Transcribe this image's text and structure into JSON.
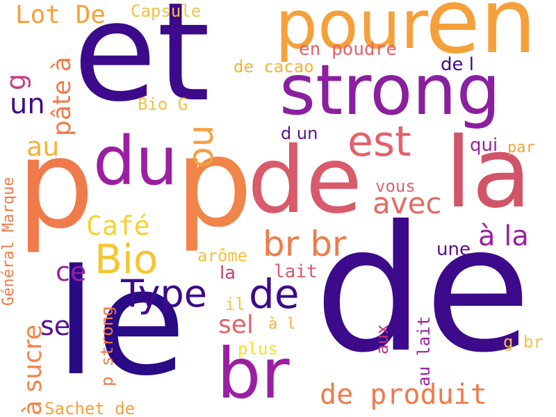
{
  "words": [
    {
      "text": "et",
      "color": "#3c0a8a",
      "rotated": false
    },
    {
      "text": "de",
      "color": "#3c0a8a",
      "rotated": false
    },
    {
      "text": "le",
      "color": "#2a0b86",
      "rotated": false
    },
    {
      "text": "p",
      "color": "#f07b4a",
      "rotated": false
    },
    {
      "text": "p",
      "color": "#f18448",
      "rotated": false
    },
    {
      "text": "de",
      "color": "#d95a6a",
      "rotated": false
    },
    {
      "text": "la",
      "color": "#d05569",
      "rotated": false
    },
    {
      "text": "en",
      "color": "#f6a03c",
      "rotated": false
    },
    {
      "text": "pour",
      "color": "#f6a03c",
      "rotated": false
    },
    {
      "text": "strong",
      "color": "#8a1fa0",
      "rotated": false
    },
    {
      "text": "du",
      "color": "#9b1fa2",
      "rotated": false
    },
    {
      "text": "br",
      "color": "#9b1fa2",
      "rotated": false
    },
    {
      "text": "Bio",
      "color": "#f8c52f",
      "rotated": false
    },
    {
      "text": "Type",
      "color": "#3c0a8a",
      "rotated": false
    },
    {
      "text": "de",
      "color": "#3c0a8a",
      "rotated": false
    },
    {
      "text": "est",
      "color": "#e4626a",
      "rotated": false
    },
    {
      "text": "br br",
      "color": "#f07b4a",
      "rotated": false
    },
    {
      "text": "avec",
      "color": "#e16b62",
      "rotated": false
    },
    {
      "text": "à la",
      "color": "#9b1fa2",
      "rotated": false
    },
    {
      "text": "de produit",
      "color": "#f07b4a",
      "rotated": false
    },
    {
      "text": "Lot De",
      "color": "#f6a03c",
      "rotated": false
    },
    {
      "text": "Capsule",
      "color": "#f6c040",
      "rotated": false
    },
    {
      "text": "en poudre",
      "color": "#e4626a",
      "rotated": false
    },
    {
      "text": "de cacao",
      "color": "#f6b334",
      "rotated": false
    },
    {
      "text": "de l",
      "color": "#3c0a8a",
      "rotated": false
    },
    {
      "text": "un",
      "color": "#3c0a8a",
      "rotated": false
    },
    {
      "text": "Bio G",
      "color": "#f6c040",
      "rotated": false
    },
    {
      "text": "d un",
      "color": "#5a0d8f",
      "rotated": false
    },
    {
      "text": "qui",
      "color": "#9b1fa2",
      "rotated": false
    },
    {
      "text": "par",
      "color": "#f6a03c",
      "rotated": false
    },
    {
      "text": "au",
      "color": "#f6b334",
      "rotated": false
    },
    {
      "text": "Café",
      "color": "#f8d22c",
      "rotated": false
    },
    {
      "text": "ce",
      "color": "#9b1fa2",
      "rotated": false
    },
    {
      "text": "se",
      "color": "#5a0d8f",
      "rotated": false
    },
    {
      "text": "sel",
      "color": "#e4626a",
      "rotated": false
    },
    {
      "text": "vous",
      "color": "#e4626a",
      "rotated": false
    },
    {
      "text": "une",
      "color": "#5a0d8f",
      "rotated": false
    },
    {
      "text": "arôme",
      "color": "#f6c040",
      "rotated": false
    },
    {
      "text": "la",
      "color": "#c83f7a",
      "rotated": false
    },
    {
      "text": "lait",
      "color": "#d95a6a",
      "rotated": false
    },
    {
      "text": "il",
      "color": "#f6c040",
      "rotated": false
    },
    {
      "text": "à l",
      "color": "#f6b334",
      "rotated": false
    },
    {
      "text": "plus",
      "color": "#f8e02a",
      "rotated": false
    },
    {
      "text": "g br",
      "color": "#f6c040",
      "rotated": false
    },
    {
      "text": "Sachet de",
      "color": "#f6a03c",
      "rotated": false
    },
    {
      "text": "g",
      "color": "#c83f7a",
      "rotated": true
    },
    {
      "text": "pâte à",
      "color": "#f07b4a",
      "rotated": true
    },
    {
      "text": "ou",
      "color": "#f6a03c",
      "rotated": true
    },
    {
      "text": "Général Marque",
      "color": "#f07b4a",
      "rotated": true
    },
    {
      "text": "à sucre",
      "color": "#f18448",
      "rotated": true
    },
    {
      "text": "p strong",
      "color": "#f07b4a",
      "rotated": true
    },
    {
      "text": "aux",
      "color": "#b9307f",
      "rotated": true
    },
    {
      "text": "au lait",
      "color": "#9b1fa2",
      "rotated": true
    }
  ]
}
